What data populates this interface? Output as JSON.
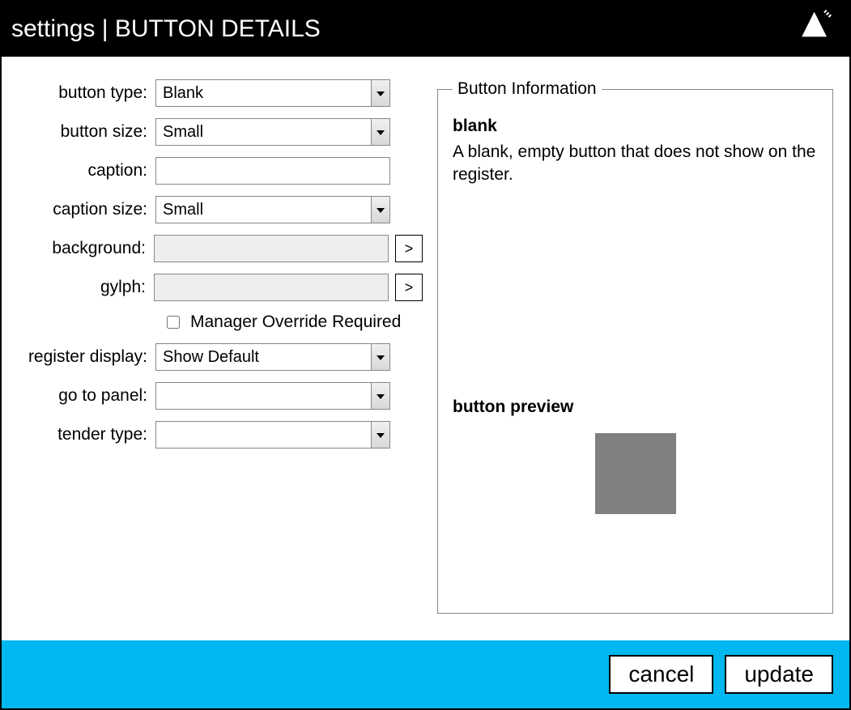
{
  "header": {
    "title": "settings | BUTTON DETAILS"
  },
  "form": {
    "button_type": {
      "label": "button type:",
      "value": "Blank"
    },
    "button_size": {
      "label": "button size:",
      "value": "Small"
    },
    "caption": {
      "label": "caption:",
      "value": ""
    },
    "caption_size": {
      "label": "caption size:",
      "value": "Small"
    },
    "background": {
      "label": "background:",
      "value": "",
      "browse": ">"
    },
    "glyph": {
      "label": "gylph:",
      "value": "",
      "browse": ">"
    },
    "manager_override": {
      "label": "Manager Override Required",
      "checked": false
    },
    "register_display": {
      "label": "register display:",
      "value": "Show Default"
    },
    "go_to_panel": {
      "label": "go to panel:",
      "value": ""
    },
    "tender_type": {
      "label": "tender type:",
      "value": ""
    }
  },
  "info": {
    "legend": "Button Information",
    "title": "blank",
    "description": "A blank, empty button that does not show on the register.",
    "preview_label": "button preview"
  },
  "footer": {
    "cancel": "cancel",
    "update": "update"
  }
}
